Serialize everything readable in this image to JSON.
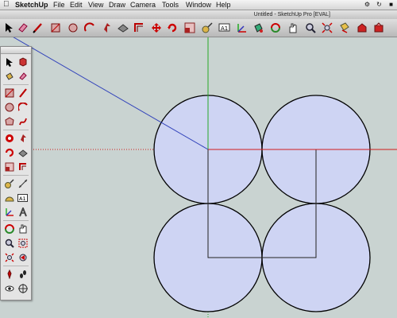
{
  "menubar": {
    "app_name": "SketchUp",
    "items": [
      "File",
      "Edit",
      "View",
      "Draw",
      "Camera",
      "Tools",
      "Window",
      "Help"
    ]
  },
  "window": {
    "title": "Untitled - SketchUp Pro [EVAL]"
  },
  "toolbar": {
    "tools": [
      "select-tool-icon",
      "eraser-tool-icon",
      "pencil-line-tool-icon",
      "rectangle-tool-icon",
      "circle-tool-icon",
      "arc-tool-icon",
      "push-pull-tool-icon",
      "follow-me-tool-icon",
      "offset-tool-icon",
      "move-tool-icon",
      "rotate-tool-icon",
      "scale-tool-icon",
      "tape-measure-tool-icon",
      "text-tool-icon",
      "axes-tool-icon",
      "paint-bucket-tool-icon",
      "orbit-tool-icon",
      "pan-tool-icon",
      "zoom-tool-icon",
      "zoom-extents-icon",
      "section-plane-icon",
      "3d-warehouse-icon",
      "component-share-icon"
    ]
  },
  "palette": {
    "tools": [
      "select-icon",
      "make-component-icon",
      "paint-bucket-icon",
      "eraser-icon",
      "rectangle-icon",
      "line-icon",
      "circle-icon",
      "arc-icon",
      "polygon-icon",
      "freehand-icon",
      "move-icon",
      "push-pull-icon",
      "rotate-icon",
      "follow-me-icon",
      "scale-icon",
      "offset-icon",
      "tape-measure-icon",
      "dimension-icon",
      "protractor-icon",
      "text-icon",
      "axes-icon",
      "3d-text-icon",
      "orbit-icon",
      "pan-icon",
      "zoom-icon",
      "zoom-window-icon",
      "zoom-extents-icon",
      "previous-view-icon",
      "position-camera-icon",
      "walk-icon",
      "look-around-icon",
      "section-plane-icon"
    ],
    "text_tool_label": "A1"
  },
  "colors": {
    "red_axis": "#d11c1c",
    "green_axis": "#27a827",
    "blue_axis": "#3344bb",
    "face_fill": "#ced4f3",
    "background": "#c9d3d1"
  }
}
